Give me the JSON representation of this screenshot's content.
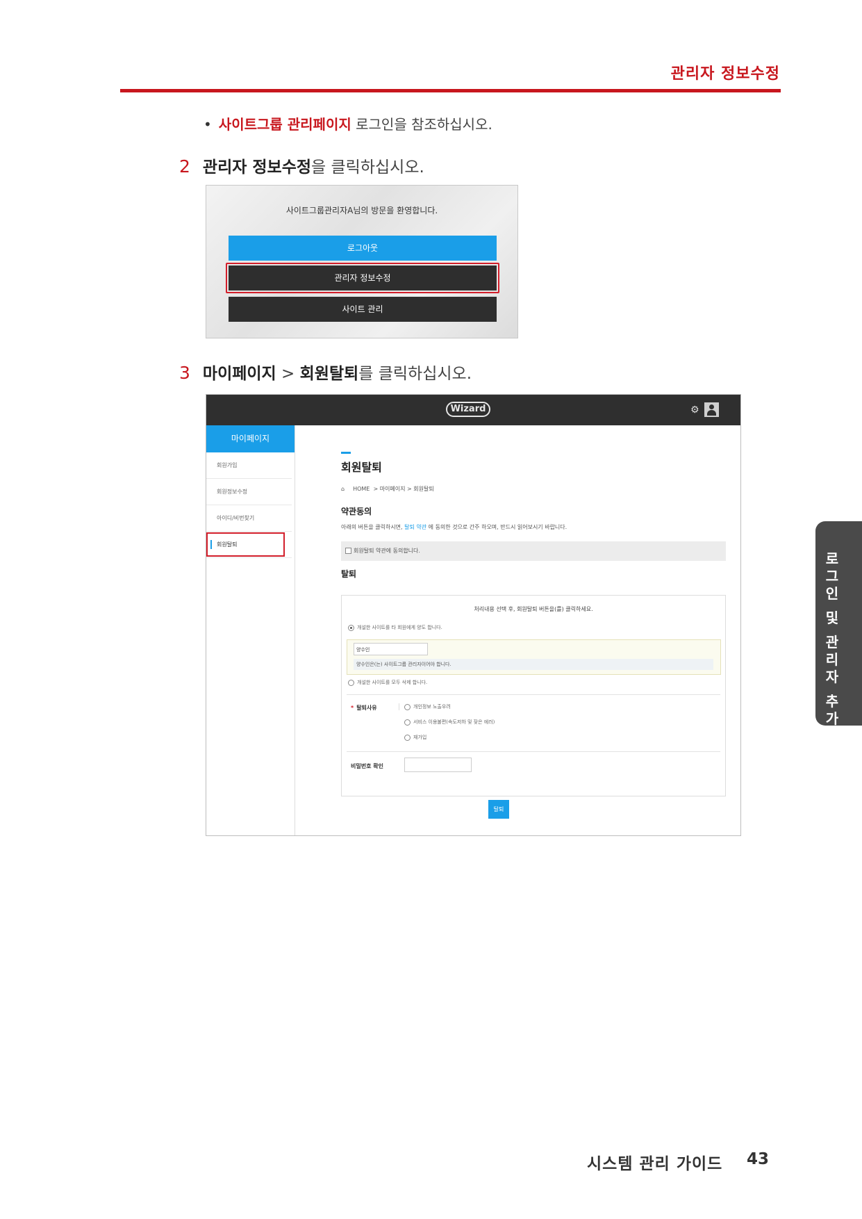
{
  "header": {
    "title": "관리자 정보수정"
  },
  "bullet": {
    "highlight": "사이트그룹 관리페이지",
    "rest": " 로그인을 참조하십시오."
  },
  "step2": {
    "number": "2",
    "bold": "관리자 정보수정",
    "rest": "을 클릭하십시오."
  },
  "shot1": {
    "welcome": "사이트그룹관리자A님의 방문을 환영합니다.",
    "logout_label": "로그아웃",
    "admin_edit_label": "관리자 정보수정",
    "site_manage_label": "사이트 관리",
    "colors": {
      "blue": "#1a9ee8",
      "dark": "#2e2e2e",
      "highlight": "#d21e2a"
    }
  },
  "step3": {
    "number": "3",
    "bold1": "마이페이지",
    "sep": " > ",
    "bold2": "회원탈퇴",
    "rest": "를 클릭하십시오."
  },
  "shot2": {
    "logo": "Wizard",
    "sidebar": {
      "title": "마이페이지",
      "items": [
        "회원가입",
        "회원정보수정",
        "아이디/비번찾기",
        "회원탈퇴"
      ],
      "active_index": 3
    },
    "page_title": "회원탈퇴",
    "breadcrumb": {
      "home": "HOME",
      "level1": "> 마이페이지",
      "level2": "> 회원탈퇴"
    },
    "terms": {
      "title": "약관동의",
      "notice_before": "아래의 버튼을 클릭하시면, ",
      "notice_link": "탈퇴 약관",
      "notice_after": " 에 동의한 것으로 간주 하오며, 반드시 읽어보시기 바랍니다.",
      "agree_label": "회원탈퇴 약관에 동의합니다."
    },
    "withdraw": {
      "title": "탈퇴",
      "instruction": "처리내용 선택 후, 회원탈퇴 버튼을(를) 클릭하세요.",
      "option_transfer": "개설한 사이트를 타 회원에게 양도 합니다.",
      "successor_value": "양수인",
      "successor_note": "양수인은(는) 사이트그룹 관리자이어야 합니다.",
      "option_delete": "개설한 사이트를 모두 삭제 합니다.",
      "reason_label": "탈퇴사유",
      "reasons": [
        "개인정보 노출우려",
        "서비스 이용불편(속도저하 및 잦은 에러)",
        "재가입"
      ],
      "password_label": "비밀번호 확인",
      "submit_label": "탈퇴"
    }
  },
  "side_tab": {
    "chars": [
      "로",
      "그",
      "인",
      "",
      "및",
      "",
      "관",
      "리",
      "자",
      "",
      "추",
      "가"
    ]
  },
  "footer": {
    "title": "시스템 관리 가이드",
    "page": "43"
  }
}
